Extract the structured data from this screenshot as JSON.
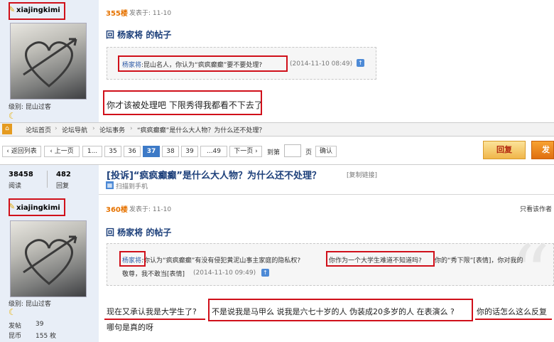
{
  "post1": {
    "username": "xiajingkimi",
    "level_label": "级别: 昆山过客",
    "floor": "355楼",
    "posted_at_label": "发表于: 11-10",
    "reply_title": "回  杨家将  的帖子",
    "quote_user": "杨家将",
    "quote_text": ":昆山名人，你认为“疯疯癫癫”要不要处理?",
    "quote_time": "(2014-11-10 08:49)",
    "content": "你才该被处理吧  下限秀得我都看不下去了"
  },
  "navbar": {
    "home": "论坛首页",
    "items": [
      "论坛导航",
      "论坛事务",
      "“疯疯癫癫”是什么大人物？为什么还不处理？"
    ]
  },
  "pagination": {
    "back": "‹ 返回列表",
    "prev": "‹ 上一页",
    "pages": [
      "1...",
      "35",
      "36",
      "37",
      "38",
      "39",
      "...49"
    ],
    "next": "下一页 ›",
    "goto_label": "到第",
    "page_unit": "页",
    "confirm": "确认",
    "reply": "回复",
    "post": "发"
  },
  "stats": {
    "views": "38458",
    "views_label": "阅读",
    "replies": "482",
    "replies_label": "回复"
  },
  "thread": {
    "title": "[投诉]“疯疯癫癫”是什么大人物？为什么还不处理？",
    "copy_link": "[复制链接]",
    "scan": "扫描到手机"
  },
  "post2": {
    "username": "xiajingkimi",
    "level_label": "级别: 昆山过客",
    "floor": "360楼",
    "posted_at_label": "发表于: 11-10",
    "author_only": "只看该作者",
    "reply_title": "回  杨家将  的帖子",
    "quote_user": "杨家将",
    "quote_text_a": ":你认为“疯疯癫癫”有没有侵犯黄泥山事主家庭的隐私权?",
    "quote_text_b": "你作为一个大学生难道不知道吗?",
    "quote_text_c": "你的“秀下限”[表情]，你对我的",
    "quote_text_d": "敬尊，我不敢当[表情]",
    "quote_time": "(2014-11-10 09:49)",
    "content_a": "现在又承认我是大学生了?",
    "content_b": "不是说我是马甲么  说我是六七十岁的人  伪装成20多岁的人  在表演么  ?",
    "content_c": "你的话怎么这么反复",
    "content_d": "哪句是真的呀",
    "stat_posts_label": "发帖",
    "stat_posts": "39",
    "stat_coins_label": "昆币",
    "stat_coins": "155 枚"
  }
}
